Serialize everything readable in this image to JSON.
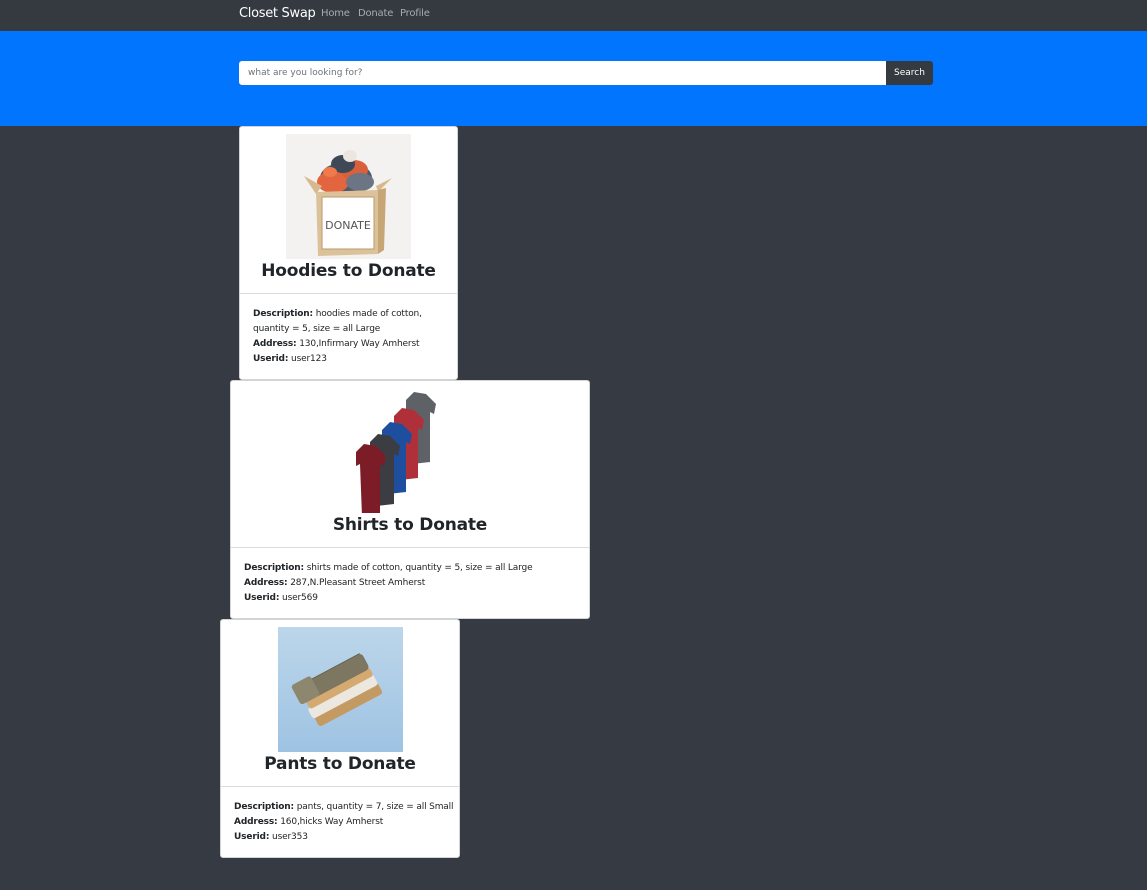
{
  "navbar": {
    "brand": "Closet Swap",
    "links": [
      "Home",
      "Donate",
      "Profile"
    ]
  },
  "search": {
    "placeholder": "what are you looking for?",
    "button_label": "Search"
  },
  "labels": {
    "description": "Description:",
    "address": "Address:",
    "userid": "Userid:"
  },
  "items": [
    {
      "title": "Hoodies to Donate",
      "description": "hoodies made of cotton, quantity = 5, size = all Large",
      "description_line1": "hoodies made of cotton,",
      "description_line2": "quantity = 5, size = all Large",
      "address": "130,Infirmary Way Amherst",
      "userid": "user123",
      "box_label": "DONATE"
    },
    {
      "title": "Shirts to Donate",
      "description": "shirts made of cotton, quantity = 5, size = all Large",
      "address": "287,N.Pleasant Street Amherst",
      "userid": "user569"
    },
    {
      "title": "Pants to Donate",
      "description": "pants, quantity = 7, size = all Small",
      "address": "160,hicks Way Amherst",
      "userid": "user353"
    }
  ],
  "colors": {
    "navbar": "#343a40",
    "hero": "#0275fe",
    "page_background": "#353a43",
    "card_background": "#ffffff"
  }
}
